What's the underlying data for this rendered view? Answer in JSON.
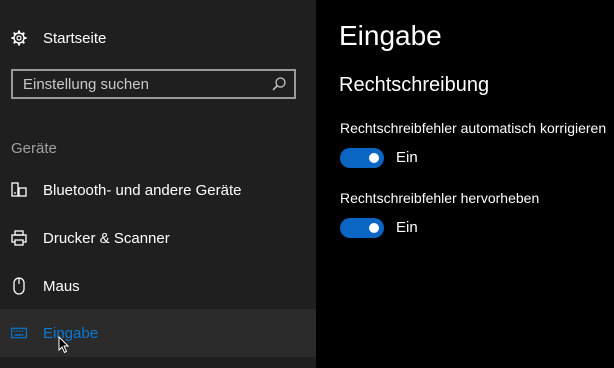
{
  "sidebar": {
    "home_label": "Startseite",
    "search": {
      "placeholder": "Einstellung suchen",
      "value": ""
    },
    "section_title": "Geräte",
    "items": [
      {
        "label": "Bluetooth- und andere Geräte",
        "icon": "bluetooth-device-icon",
        "selected": false
      },
      {
        "label": "Drucker & Scanner",
        "icon": "printer-icon",
        "selected": false
      },
      {
        "label": "Maus",
        "icon": "mouse-icon",
        "selected": false
      },
      {
        "label": "Eingabe",
        "icon": "keyboard-icon",
        "selected": true
      }
    ]
  },
  "main": {
    "title": "Eingabe",
    "section_title": "Rechtschreibung",
    "settings": [
      {
        "label": "Rechtschreibfehler automatisch korrigieren",
        "state": "Ein",
        "on": true
      },
      {
        "label": "Rechtschreibfehler hervorheben",
        "state": "Ein",
        "on": true
      }
    ]
  },
  "colors": {
    "accent": "#0a78d7",
    "toggle_on": "#0a66c2",
    "sidebar_bg": "#1f1f1f",
    "selected_bg": "#2b2b2b",
    "main_bg": "#000000"
  }
}
